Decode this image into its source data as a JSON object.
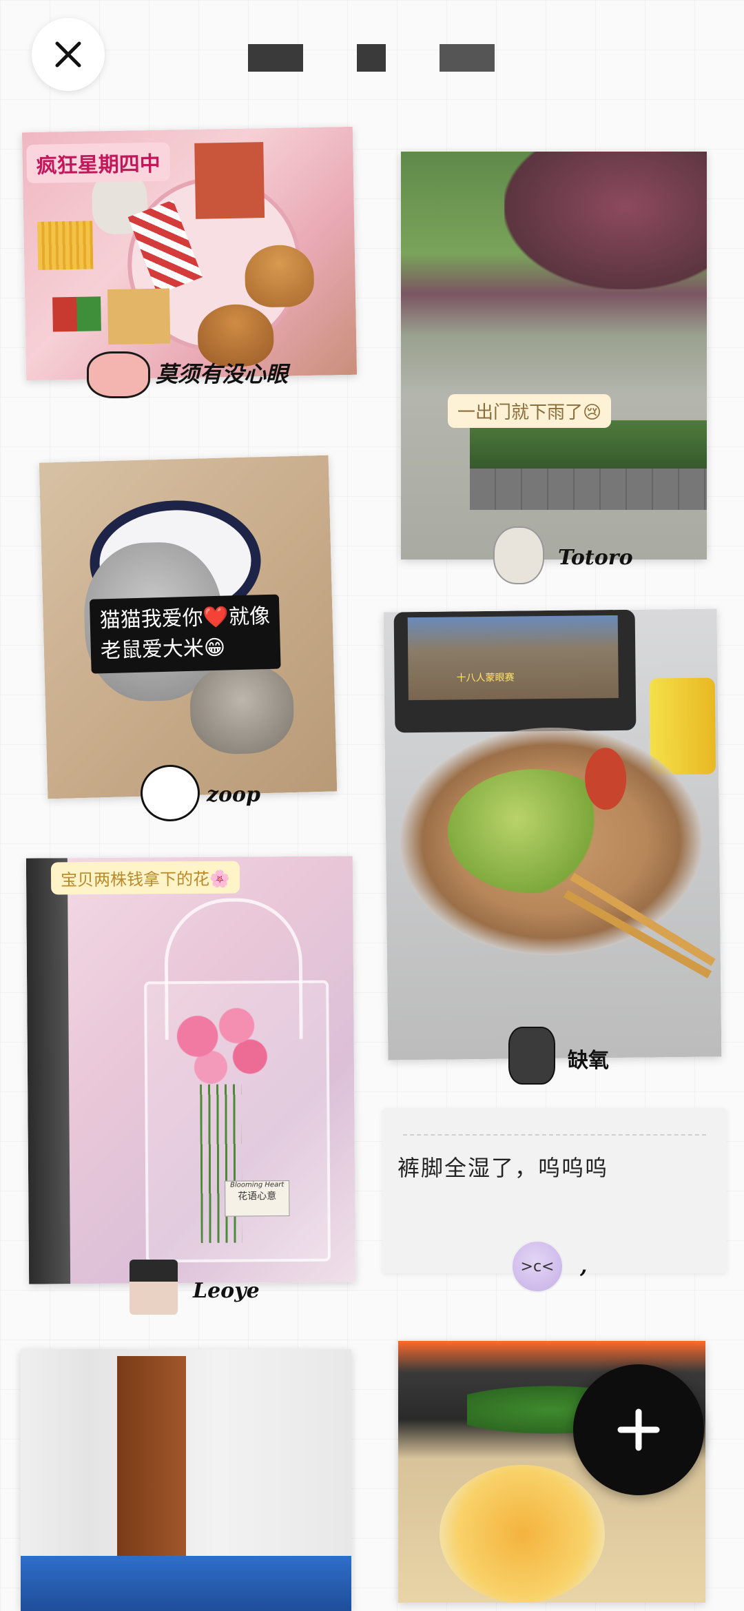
{
  "header": {
    "close_icon": "close-icon"
  },
  "posts": {
    "p1": {
      "tag": "疯狂星期四中",
      "author": "莫须有没心眼"
    },
    "p2": {
      "tag": "一出门就下雨了😢",
      "author": "Totoro"
    },
    "p3": {
      "caption_line1": "猫猫我爱你❤️就像",
      "caption_line2": "老鼠爱大米😁",
      "author": "zoop"
    },
    "p4": {
      "tv_caption": "十八人蒙眼赛",
      "author": "缺氧"
    },
    "p5": {
      "tag": "宝贝两株钱拿下的花🌸",
      "author": "Leoye",
      "card_label": "花语心意",
      "card_sub": "Blooming Heart"
    },
    "p6": {
      "text": "裤脚全湿了，呜呜呜",
      "author": ","
    }
  },
  "fab": {
    "icon": "plus-icon"
  },
  "colors": {
    "fab": "#0d0d0d",
    "tag_pink": "#fbd5dd",
    "tag_yellow": "#fff3c8",
    "tag_cream": "#fdf1d6"
  }
}
